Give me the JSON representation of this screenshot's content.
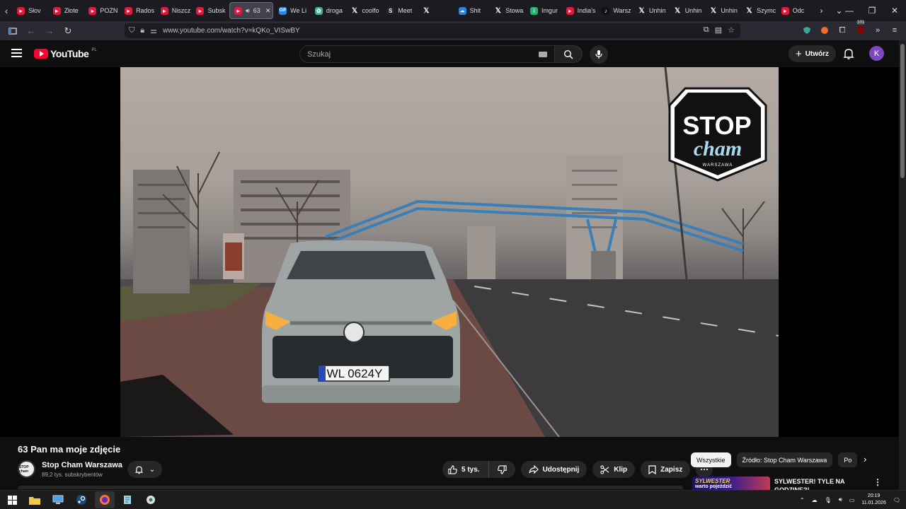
{
  "browser": {
    "tabs": [
      {
        "label": "Słov",
        "icon": "youtube-icon"
      },
      {
        "label": "Złote",
        "icon": "youtube-icon"
      },
      {
        "label": "POZN",
        "icon": "youtube-icon"
      },
      {
        "label": "Rados",
        "icon": "youtube-icon"
      },
      {
        "label": "Niszcz",
        "icon": "youtube-icon"
      },
      {
        "label": "Subsk",
        "icon": "youtube-icon"
      },
      {
        "label": "63",
        "icon": "youtube-icon",
        "active": true,
        "playing": true
      },
      {
        "label": "We Li",
        "icon": "gif-icon"
      },
      {
        "label": "droga",
        "icon": "leaf-icon"
      },
      {
        "label": "coolfo",
        "icon": "x-icon"
      },
      {
        "label": "Meet",
        "icon": "substack-icon"
      },
      {
        "label": "",
        "icon": "x-icon"
      },
      {
        "label": "Shit",
        "icon": "bluesky-icon"
      },
      {
        "label": "Stowa",
        "icon": "x-icon"
      },
      {
        "label": "Imgur",
        "icon": "imgur-icon"
      },
      {
        "label": "India's",
        "icon": "youtube-icon"
      },
      {
        "label": "Warsz",
        "icon": "tiktok-icon"
      },
      {
        "label": "Unhin",
        "icon": "x-icon"
      },
      {
        "label": "Unhin",
        "icon": "x-icon"
      },
      {
        "label": "Unhin",
        "icon": "x-icon"
      },
      {
        "label": "Szymc",
        "icon": "x-icon"
      },
      {
        "label": "Odc",
        "icon": "youtube-icon"
      }
    ],
    "url": "www.youtube.com/watch?v=kQKo_VISwBY",
    "extension_badge": "101"
  },
  "youtube": {
    "logo_text": "YouTube",
    "logo_region": "PL",
    "search_placeholder": "Szukaj",
    "create_label": "Utwórz",
    "avatar_letter": "K"
  },
  "video": {
    "title": "63 Pan ma moje zdjęcie",
    "watermark_top": "STOP",
    "watermark_mid": "cham",
    "watermark_bottom": "WARSZAWA",
    "plate": "WL 0624Y"
  },
  "channel": {
    "name": "Stop Cham Warszawa",
    "subscribers": "89,2 tys. subskrybentów",
    "avatar_text": "STOP cham"
  },
  "actions": {
    "likes": "5 tys.",
    "share": "Udostępnij",
    "clip": "Klip",
    "save": "Zapisz"
  },
  "chips": [
    "Wszystkie",
    "Źródło: Stop Cham Warszawa",
    "Po"
  ],
  "recommendation": {
    "thumb_line1": "SYLWESTER",
    "thumb_line2": "warto pojeździć",
    "title": "SYLWESTER! TYLE NA GODZINE?!"
  },
  "taskbar": {
    "time": "20:19",
    "date": "11.01.2026"
  },
  "colors": {
    "youtube_red": "#ff0033",
    "background": "#0f0f0f",
    "pill": "#272727",
    "avatar": "#7e47c2"
  }
}
